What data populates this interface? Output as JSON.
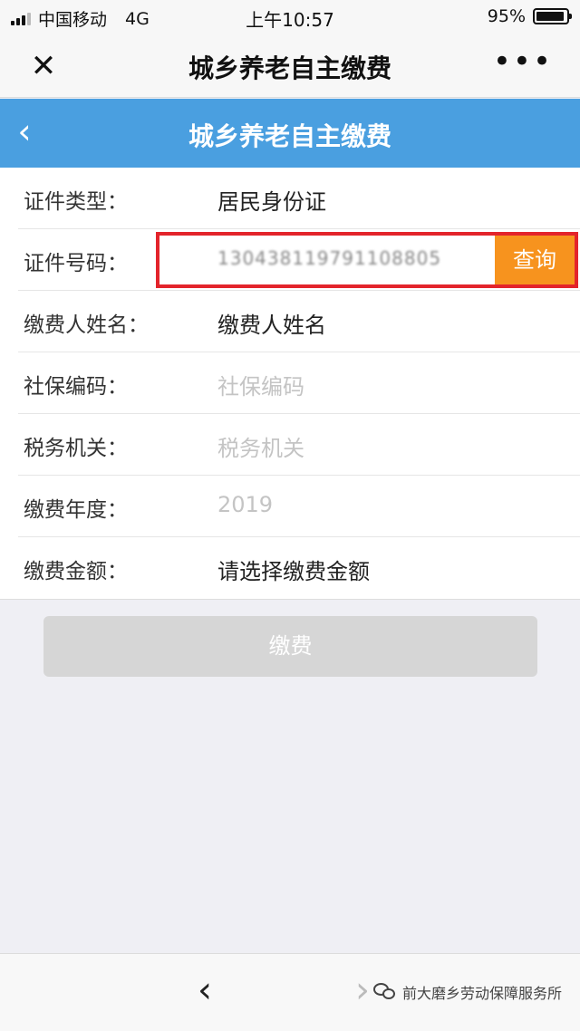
{
  "status_bar": {
    "carrier": "中国移动",
    "network": "4G",
    "time": "上午10:57",
    "battery_text": "95%",
    "battery_level": 0.95
  },
  "wx_header": {
    "title": "城乡养老自主缴费",
    "close_icon": "close-icon",
    "more_icon": "more-icon"
  },
  "nav": {
    "title": "城乡养老自主缴费",
    "back_icon": "chevron-left-icon"
  },
  "form": {
    "rows": [
      {
        "label": "证件类型：",
        "value": "居民身份证"
      },
      {
        "label": "证件号码：",
        "value": "130438119791108805",
        "button": "查询"
      },
      {
        "label": "缴费人姓名：",
        "value": "缴费人姓名"
      },
      {
        "label": "社保编码：",
        "placeholder": "社保编码"
      },
      {
        "label": "税务机关：",
        "placeholder": "税务机关"
      },
      {
        "label": "缴费年度：",
        "placeholder": "2019"
      },
      {
        "label": "缴费金额：",
        "value": "请选择缴费金额"
      }
    ]
  },
  "pay_button": "缴费",
  "bottom_bar": {
    "back_icon": "chevron-left-icon",
    "forward_icon": "chevron-right-icon",
    "watermark": "前大磨乡劳动保障服务所"
  },
  "colors": {
    "nav_blue": "#4a9fe0",
    "query_orange": "#f7931e",
    "highlight_red": "#e3242b",
    "disabled_gray": "#d6d6d6"
  }
}
